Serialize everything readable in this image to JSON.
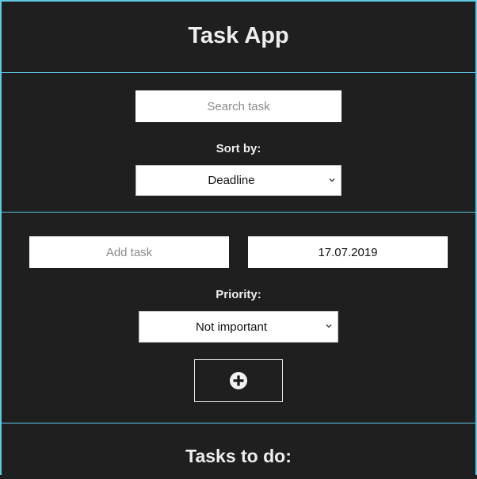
{
  "app": {
    "title": "Task App"
  },
  "search": {
    "placeholder": "Search task",
    "value": "",
    "sort_label": "Sort by:",
    "sort_selected": "Deadline"
  },
  "add_task": {
    "placeholder": "Add task",
    "value": "",
    "date_value": "17.07.2019",
    "priority_label": "Priority:",
    "priority_selected": "Not important",
    "add_button_icon": "plus-circle-icon"
  },
  "todo": {
    "title": "Tasks to do:"
  },
  "colors": {
    "background": "#1f1f1f",
    "accent_border": "#5ec8e5",
    "text": "#eeeeee",
    "input_bg": "#ffffff"
  }
}
